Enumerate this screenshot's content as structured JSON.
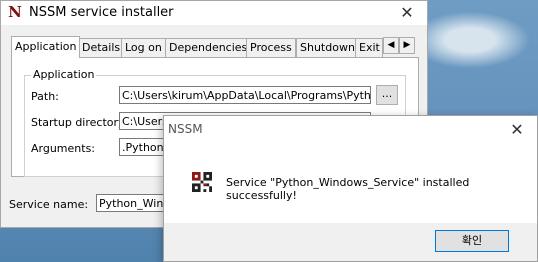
{
  "main_window": {
    "title": "NSSM service installer",
    "tabs": [
      "Application",
      "Details",
      "Log on",
      "Dependencies",
      "Process",
      "Shutdown",
      "Exit"
    ],
    "active_tab": "Application",
    "group_title": "Application",
    "fields": {
      "path": {
        "label": "Path:",
        "value": "C:\\Users\\kirum\\AppData\\Local\\Programs\\Python\\P"
      },
      "startup_directory": {
        "label": "Startup directory:",
        "value": "C:\\Users\\kirum\\AppData\\Local\\Programs\\Python\\P"
      },
      "arguments": {
        "label": "Arguments:",
        "value": ".Python_W"
      }
    },
    "browse_label": "...",
    "service_name": {
      "label": "Service name:",
      "value": "Python_Windo"
    }
  },
  "dialog": {
    "title": "NSSM",
    "message": "Service \"Python_Windows_Service\" installed successfully!",
    "ok_label": "확인",
    "icon": "qr-code-icon"
  }
}
